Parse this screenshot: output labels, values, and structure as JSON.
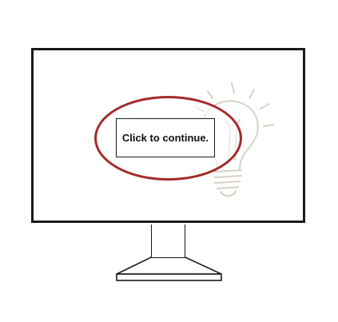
{
  "screen": {
    "button_label": "Click to continue."
  },
  "colors": {
    "frame": "#1a1a1a",
    "highlight": "#a52a2a",
    "watermark": "#d8d2c4"
  },
  "icons": {
    "watermark": "lightbulb-icon"
  }
}
